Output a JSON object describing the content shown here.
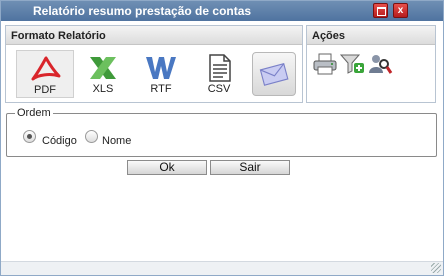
{
  "window": {
    "title": "Relatório resumo prestação de contas",
    "close_label": "x"
  },
  "formato": {
    "header": "Formato Relatório",
    "items": [
      {
        "label": "PDF",
        "icon": "pdf-icon",
        "selected": true,
        "color": "#d9252b"
      },
      {
        "label": "XLS",
        "icon": "xls-icon",
        "selected": false,
        "color": "#3f9a3a"
      },
      {
        "label": "RTF",
        "icon": "rtf-icon",
        "selected": false,
        "color": "#4a78c2"
      },
      {
        "label": "CSV",
        "icon": "csv-icon",
        "selected": false,
        "color": "#555555"
      },
      {
        "label": "",
        "icon": "email-icon",
        "selected": false,
        "color": "#8a8fd6"
      }
    ]
  },
  "acoes": {
    "header": "Ações",
    "items": [
      {
        "icon": "printer-icon"
      },
      {
        "icon": "add-filter-icon"
      },
      {
        "icon": "search-user-icon"
      }
    ]
  },
  "ordem": {
    "legend": "Ordem",
    "options": [
      {
        "label": "Código",
        "checked": true
      },
      {
        "label": "Nome",
        "checked": false
      }
    ]
  },
  "buttons": {
    "ok": "Ok",
    "sair": "Sair"
  }
}
